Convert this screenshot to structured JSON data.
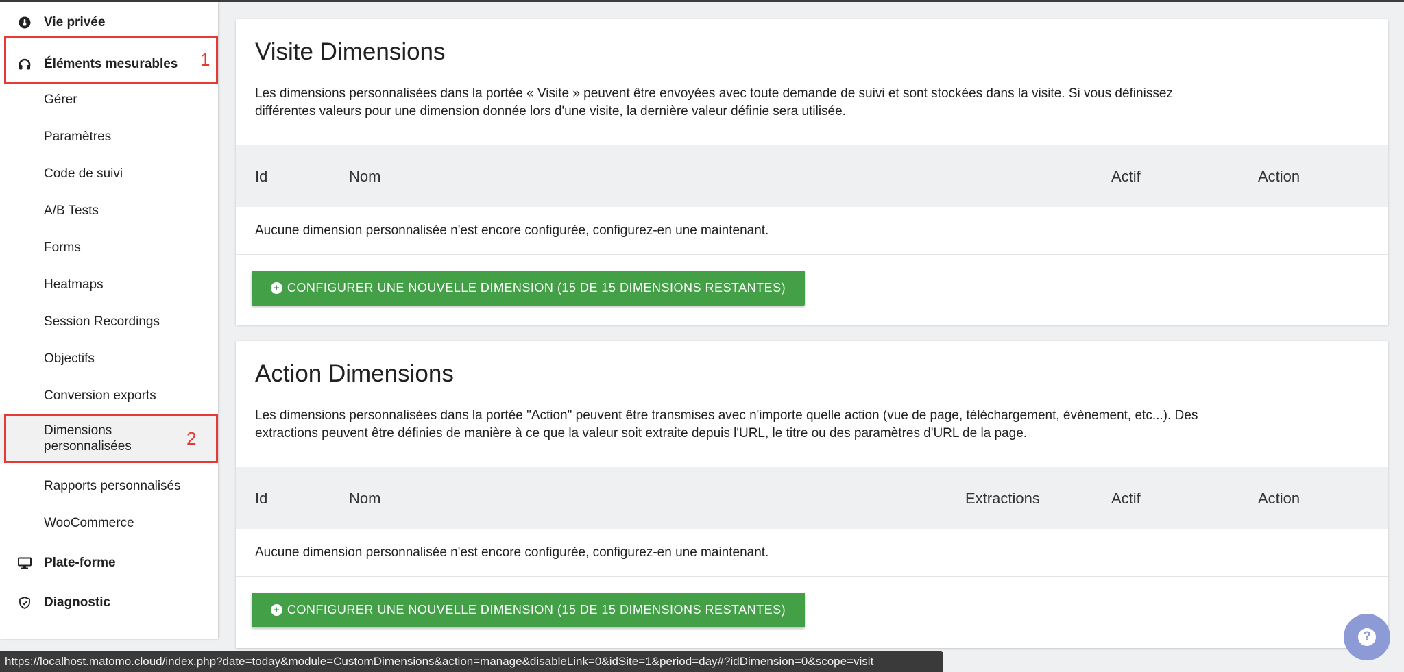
{
  "sidebar": {
    "sections": {
      "privacy": "Vie privée",
      "measurables": "Éléments mesurables",
      "platform": "Plate-forme",
      "diagnostic": "Diagnostic"
    },
    "items": [
      "Gérer",
      "Paramètres",
      "Code de suivi",
      "A/B Tests",
      "Forms",
      "Heatmaps",
      "Session Recordings",
      "Objectifs",
      "Conversion exports",
      "Dimensions personnalisées",
      "Rapports personnalisés",
      "WooCommerce"
    ],
    "markers": [
      "1",
      "2"
    ],
    "highlight_color": "#e53935"
  },
  "visit": {
    "title": "Visite Dimensions",
    "description": "Les dimensions personnalisées dans la portée « Visite » peuvent être envoyées avec toute demande de suivi et sont stockées dans la visite. Si vous définissez différentes valeurs pour une dimension donnée lors d'une visite, la dernière valeur définie sera utilisée.",
    "columns": [
      "Id",
      "Nom",
      "Actif",
      "Action"
    ],
    "empty": "Aucune dimension personnalisée n'est encore configurée, configurez-en une maintenant.",
    "button": "CONFIGURER UNE NOUVELLE DIMENSION (15 DE 15 DIMENSIONS RESTANTES)"
  },
  "action": {
    "title": "Action Dimensions",
    "description": "Les dimensions personnalisées dans la portée \"Action\" peuvent être transmises avec n'importe quelle action (vue de page, téléchargement, évènement, etc...). Des extractions peuvent être définies de manière à ce que la valeur soit extraite depuis l'URL, le titre ou des paramètres d'URL de la page.",
    "columns": [
      "Id",
      "Nom",
      "Extractions",
      "Actif",
      "Action"
    ],
    "empty": "Aucune dimension personnalisée n'est encore configurée, configurez-en une maintenant.",
    "button": "CONFIGURER UNE NOUVELLE DIMENSION (15 DE 15 DIMENSIONS RESTANTES)"
  },
  "statusbar": {
    "url": "https://localhost.matomo.cloud/index.php?date=today&module=CustomDimensions&action=manage&disableLink=0&idSite=1&period=day#?idDimension=0&scope=visit"
  },
  "help": {
    "icon": "question-icon"
  },
  "colors": {
    "button_green": "#43a047",
    "help_blue": "#8c9bd6"
  }
}
